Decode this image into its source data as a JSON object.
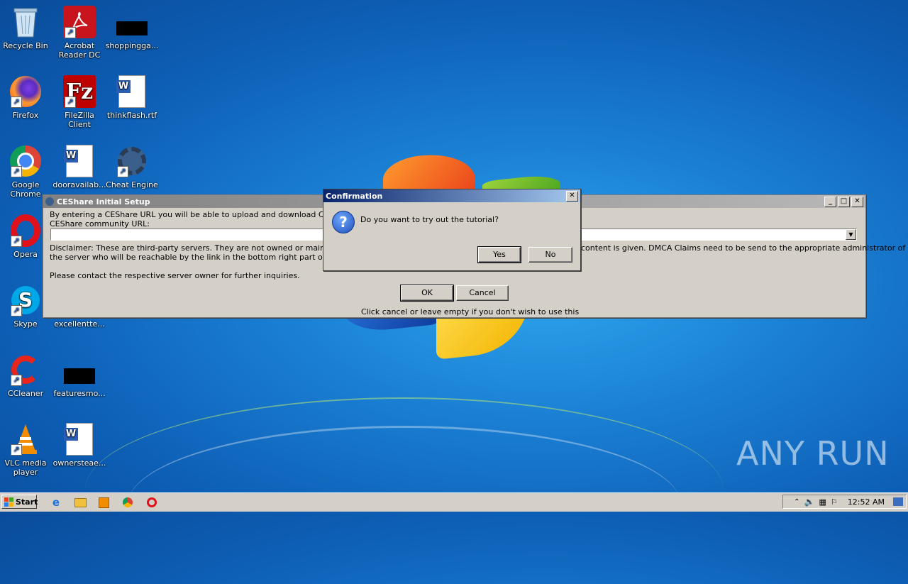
{
  "desktop": {
    "icons": [
      {
        "label": "Recycle Bin"
      },
      {
        "label": "Acrobat Reader DC"
      },
      {
        "label": "shoppingga..."
      },
      {
        "label": "Firefox"
      },
      {
        "label": "FileZilla Client"
      },
      {
        "label": "thinkflash.rtf"
      },
      {
        "label": "Google Chrome"
      },
      {
        "label": "dooravailab..."
      },
      {
        "label": "Cheat Engine"
      },
      {
        "label": "Opera"
      },
      {
        "label": "Skype"
      },
      {
        "label": "excellentte..."
      },
      {
        "label": "CCleaner"
      },
      {
        "label": "featuresmo..."
      },
      {
        "label": "VLC media player"
      },
      {
        "label": "ownersteae..."
      }
    ],
    "watermark": "ANY RUN"
  },
  "setup_window": {
    "title": "CEShare Initial Setup",
    "intro_text": "By entering a CEShare URL you will be able to upload and download Cheat Table",
    "url_label": "CEShare community URL:",
    "url_value": "",
    "disclaimer_left": "Disclaimer: These are third-party servers. They are not owned or maintained by",
    "disclaimer_left_2": "the server who will be reachable by the link in the bottom right part of a cheat ta",
    "disclaimer_right": "content is given.  DMCA Claims need to be send to the appropriate administrator of",
    "contact_text": "Please contact the respective server owner for further inquiries.",
    "ok_label": "OK",
    "cancel_label": "Cancel",
    "hint_text": "Click cancel or leave empty if you don't wish to use this"
  },
  "confirm_dialog": {
    "title": "Confirmation",
    "message": "Do you want to try out the tutorial?",
    "yes_label": "Yes",
    "no_label": "No",
    "close_glyph": "✕",
    "question_glyph": "?"
  },
  "taskbar": {
    "start_label": "Start",
    "clock": "12:52 AM"
  }
}
